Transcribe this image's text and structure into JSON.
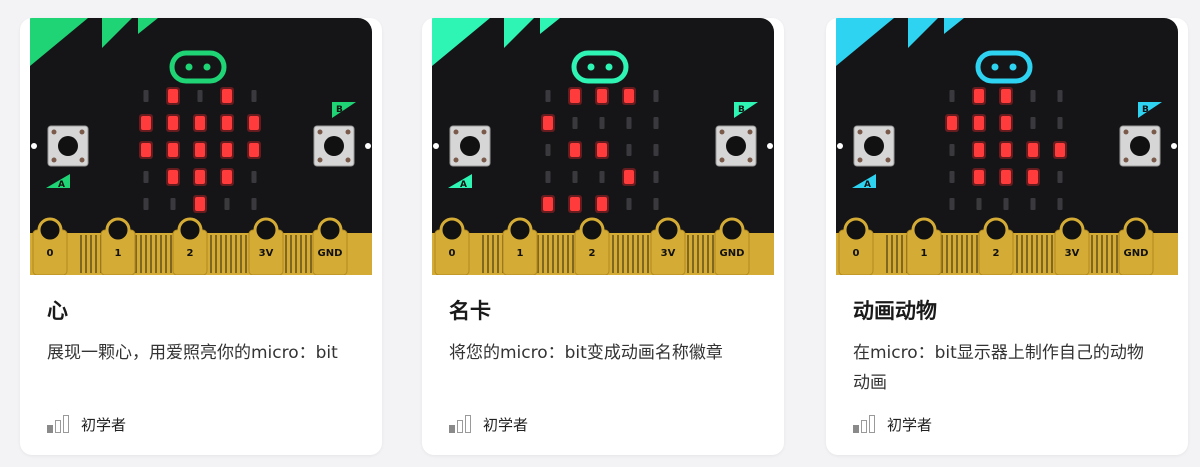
{
  "cards": [
    {
      "title": "心",
      "description": "展现一颗心，用爱照亮你的micro：bit",
      "level": "初学者",
      "accent": "#1fd474",
      "image_icon": "microbit-board",
      "leds": [
        [
          0,
          1,
          0,
          1,
          0
        ],
        [
          1,
          1,
          1,
          1,
          1
        ],
        [
          1,
          1,
          1,
          1,
          1
        ],
        [
          0,
          1,
          1,
          1,
          0
        ],
        [
          0,
          0,
          1,
          0,
          0
        ]
      ],
      "pins": [
        "0",
        "1",
        "2",
        "3V",
        "GND"
      ],
      "buttons": [
        "A",
        "B"
      ]
    },
    {
      "title": "名卡",
      "description": "将您的micro：bit变成动画名称徽章",
      "level": "初学者",
      "accent": "#2ef5b3",
      "image_icon": "microbit-board",
      "leds": [
        [
          0,
          1,
          1,
          1,
          0
        ],
        [
          1,
          0,
          0,
          0,
          0
        ],
        [
          0,
          1,
          1,
          0,
          0
        ],
        [
          0,
          0,
          0,
          1,
          0
        ],
        [
          1,
          1,
          1,
          0,
          0
        ]
      ],
      "pins": [
        "0",
        "1",
        "2",
        "3V",
        "GND"
      ],
      "buttons": [
        "A",
        "B"
      ]
    },
    {
      "title": "动画动物",
      "description": "在micro：bit显示器上制作自己的动物动画",
      "level": "初学者",
      "accent": "#2fd3f2",
      "image_icon": "microbit-board",
      "leds": [
        [
          0,
          1,
          1,
          0,
          0
        ],
        [
          1,
          1,
          1,
          0,
          0
        ],
        [
          0,
          1,
          1,
          1,
          1
        ],
        [
          0,
          1,
          1,
          1,
          0
        ],
        [
          0,
          0,
          0,
          0,
          0
        ]
      ],
      "pins": [
        "0",
        "1",
        "2",
        "3V",
        "GND"
      ],
      "buttons": [
        "A",
        "B"
      ]
    }
  ]
}
